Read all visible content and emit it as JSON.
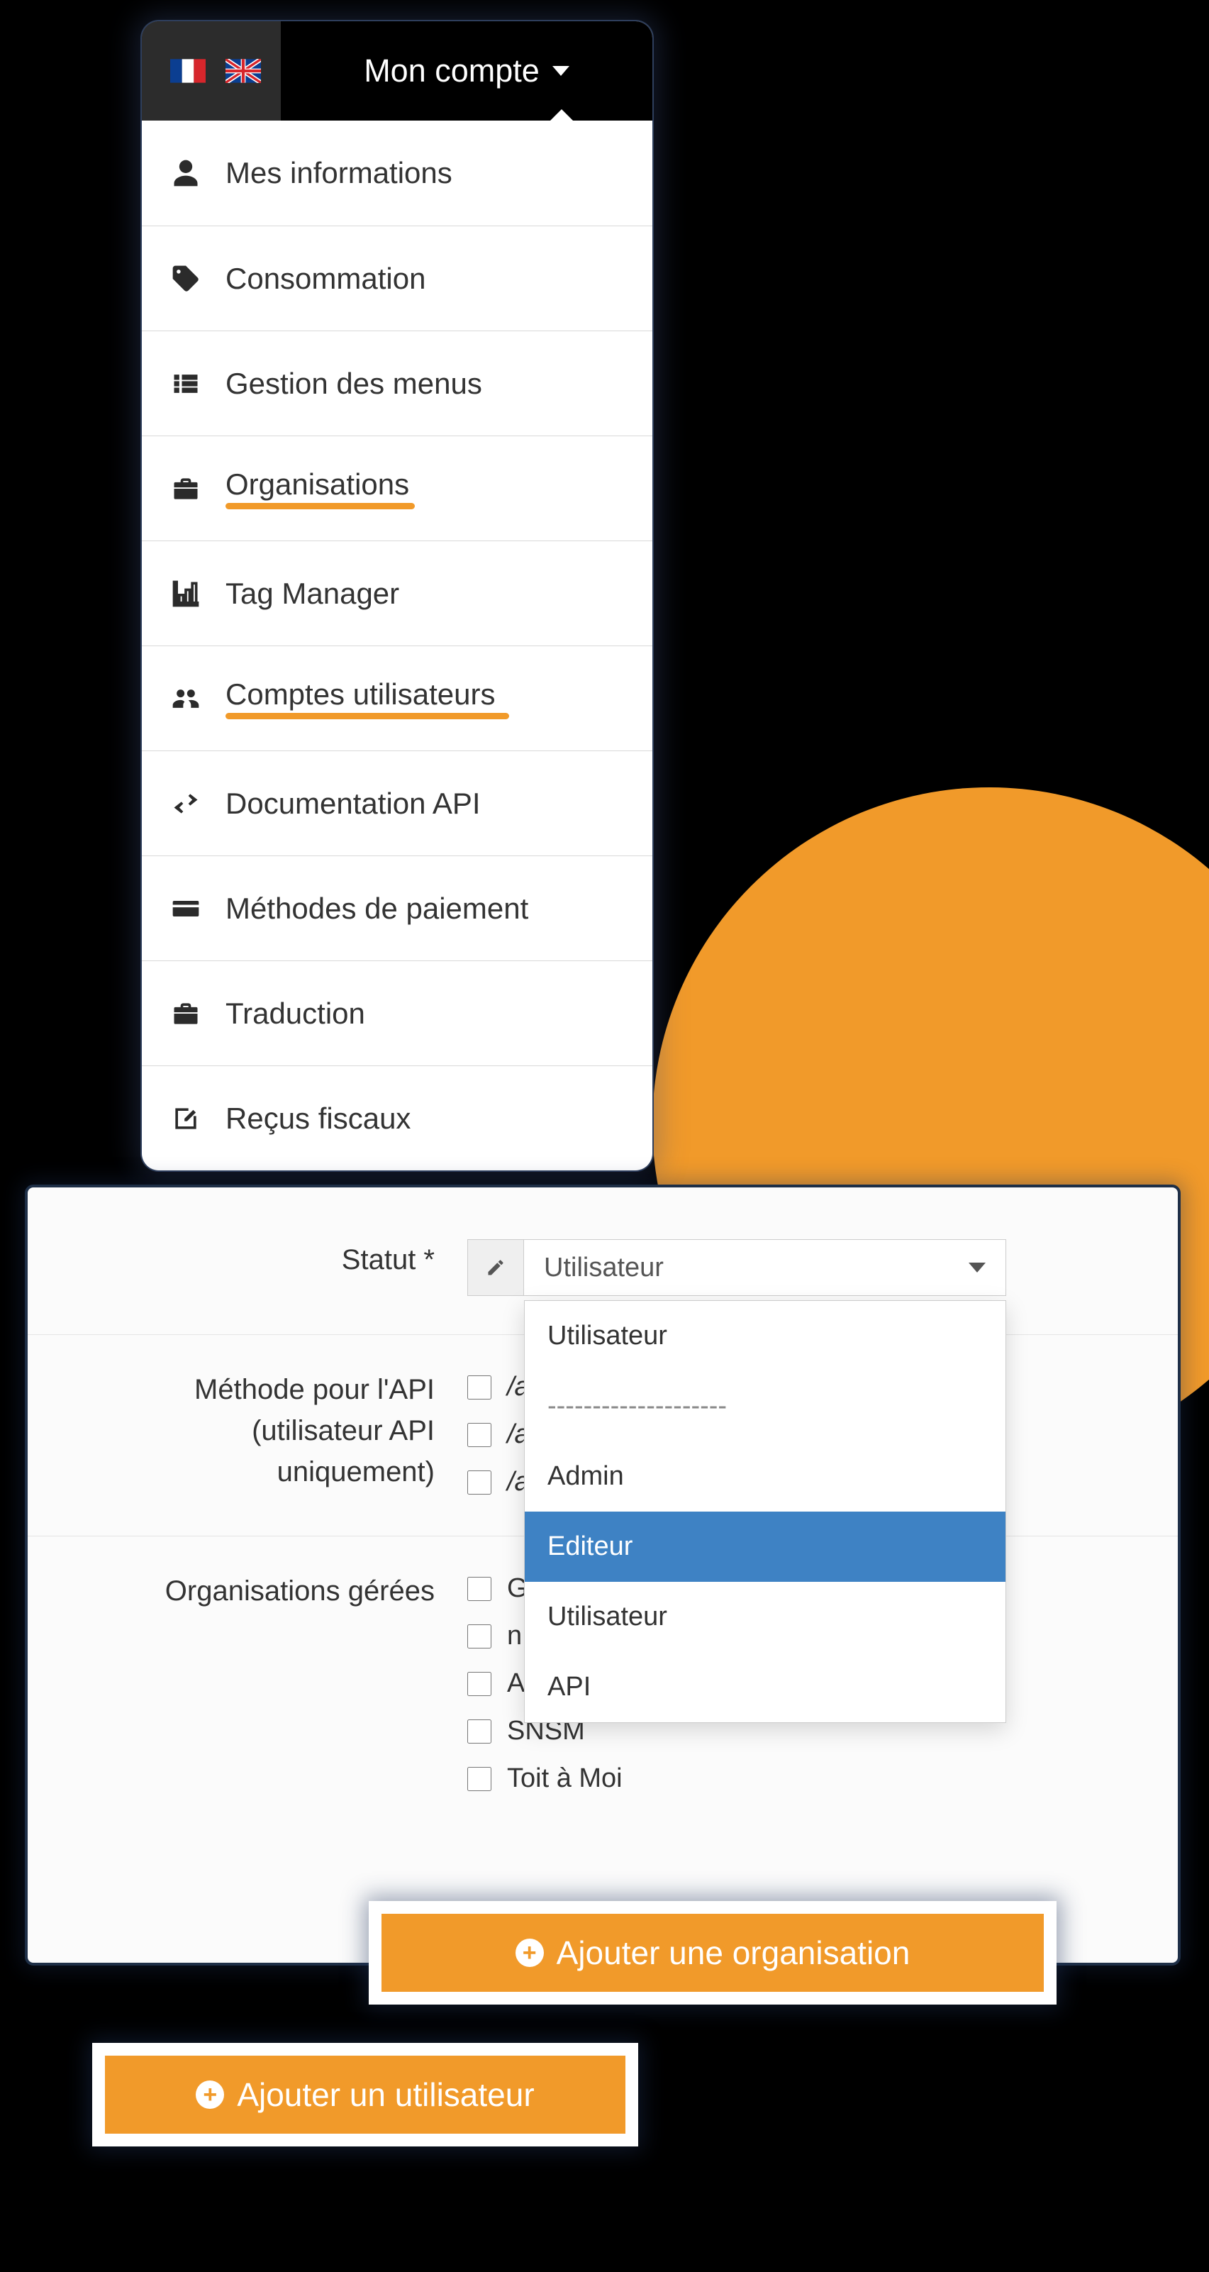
{
  "header": {
    "account_label": "Mon compte"
  },
  "menu": {
    "items": [
      {
        "icon": "user",
        "label": "Mes informations",
        "underline": false
      },
      {
        "icon": "tag",
        "label": "Consommation",
        "underline": false
      },
      {
        "icon": "list",
        "label": "Gestion des menus",
        "underline": false
      },
      {
        "icon": "briefcase",
        "label": "Organisations",
        "underline": true
      },
      {
        "icon": "chart",
        "label": "Tag Manager",
        "underline": false
      },
      {
        "icon": "users",
        "label": "Comptes utilisateurs",
        "underline": true
      },
      {
        "icon": "exchange",
        "label": "Documentation API",
        "underline": false
      },
      {
        "icon": "card",
        "label": "Méthodes de paiement",
        "underline": false
      },
      {
        "icon": "briefcase",
        "label": "Traduction",
        "underline": false
      },
      {
        "icon": "edit",
        "label": "Reçus fiscaux",
        "underline": false
      }
    ]
  },
  "form": {
    "status_label": "Statut *",
    "status_selected": "Utilisateur",
    "status_options": [
      "Utilisateur",
      "--------------------",
      "Admin",
      "Editeur",
      "Utilisateur",
      "API"
    ],
    "status_highlight_index": 3,
    "api_label_line1": "Méthode pour l'API",
    "api_label_line2": "(utilisateur API",
    "api_label_line3": "uniquement)",
    "api_items": [
      "/a",
      "/a",
      "/a"
    ],
    "orgs_label": "Organisations gérées",
    "orgs_items_cut": [
      "G",
      "n"
    ],
    "orgs_items": [
      "APSynergy",
      "SNSM",
      "Toit à Moi"
    ]
  },
  "buttons": {
    "add_org": "Ajouter une organisation",
    "add_user": "Ajouter un utilisateur"
  }
}
